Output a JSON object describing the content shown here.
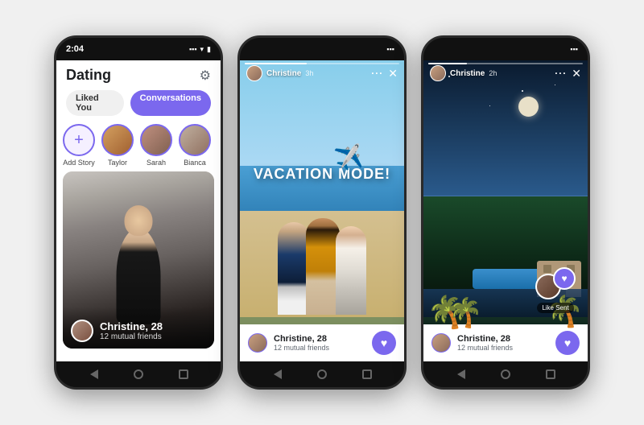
{
  "phone1": {
    "time": "2:04",
    "title": "Dating",
    "tabs": {
      "liked": "Liked You",
      "conversations": "Conversations"
    },
    "stories": [
      {
        "label": "Add Story",
        "type": "add"
      },
      {
        "label": "Taylor",
        "type": "avatar"
      },
      {
        "label": "Sarah",
        "type": "avatar"
      },
      {
        "label": "Bianca",
        "type": "avatar"
      }
    ],
    "profile": {
      "name": "Christine, 28",
      "mutual": "12 mutual friends"
    }
  },
  "phone2": {
    "user": "Christine",
    "time": "3h",
    "story_text": "VACATION MODE!",
    "plane": "✈️",
    "profile": {
      "name": "Christine, 28",
      "mutual": "12 mutual friends"
    }
  },
  "phone3": {
    "user": "Christine",
    "time": "2h",
    "like_sent_label": "Like Sent",
    "profile": {
      "name": "Christine, 28",
      "mutual": "12 mutual friends"
    }
  },
  "icons": {
    "gear": "⚙",
    "close": "✕",
    "dots": "···",
    "heart": "♥",
    "plus": "+"
  }
}
